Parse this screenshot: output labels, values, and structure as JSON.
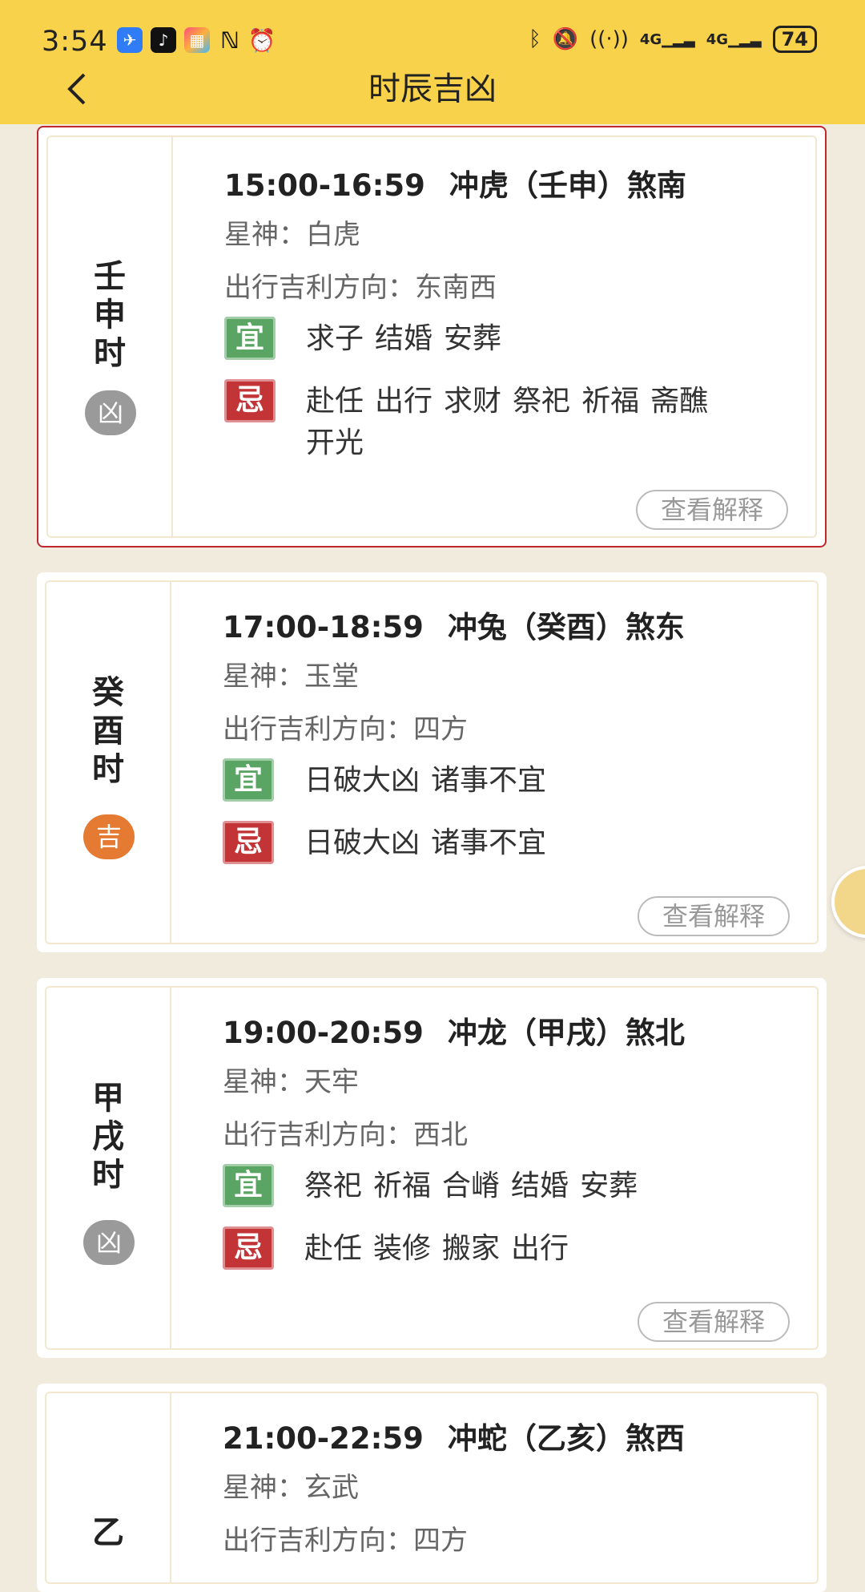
{
  "status": {
    "time": "3:54",
    "battery": "74",
    "signal1": "4G",
    "signal2": "4G"
  },
  "header": {
    "title": "时辰吉凶"
  },
  "hours": [
    {
      "name_chars": [
        "壬",
        "申",
        "时"
      ],
      "luck": "凶",
      "time": "15:00-16:59",
      "chong": "冲虎（壬申）煞南",
      "star_label": "星神：",
      "star": "白虎",
      "dir_label": "出行吉利方向：",
      "direction": "东南西",
      "yi_label": "宜",
      "yi": [
        "求子",
        "结婚",
        "安葬"
      ],
      "ji_label": "忌",
      "ji_line1": [
        "赴任",
        "出行",
        "求财",
        "祭祀",
        "祈福",
        "斋醮"
      ],
      "ji_line2": [
        "开光"
      ],
      "explain": "查看解释"
    },
    {
      "name_chars": [
        "癸",
        "酉",
        "时"
      ],
      "luck": "吉",
      "time": "17:00-18:59",
      "chong": "冲兔（癸酉）煞东",
      "star_label": "星神：",
      "star": "玉堂",
      "dir_label": "出行吉利方向：",
      "direction": "四方",
      "yi_label": "宜",
      "yi": [
        "日破大凶",
        "诸事不宜"
      ],
      "ji_label": "忌",
      "ji_line1": [
        "日破大凶",
        "诸事不宜"
      ],
      "explain": "查看解释"
    },
    {
      "name_chars": [
        "甲",
        "戌",
        "时"
      ],
      "luck": "凶",
      "time": "19:00-20:59",
      "chong": "冲龙（甲戌）煞北",
      "star_label": "星神：",
      "star": "天牢",
      "dir_label": "出行吉利方向：",
      "direction": "西北",
      "yi_label": "宜",
      "yi": [
        "祭祀",
        "祈福",
        "合嵴",
        "结婚",
        "安葬"
      ],
      "ji_label": "忌",
      "ji_line1": [
        "赴任",
        "装修",
        "搬家",
        "出行"
      ],
      "explain": "查看解释"
    },
    {
      "name_chars": [
        "乙"
      ],
      "time": "21:00-22:59",
      "chong": "冲蛇（乙亥）煞西",
      "star_label": "星神：",
      "star": "玄武",
      "dir_label": "出行吉利方向：",
      "direction": "四方"
    }
  ]
}
